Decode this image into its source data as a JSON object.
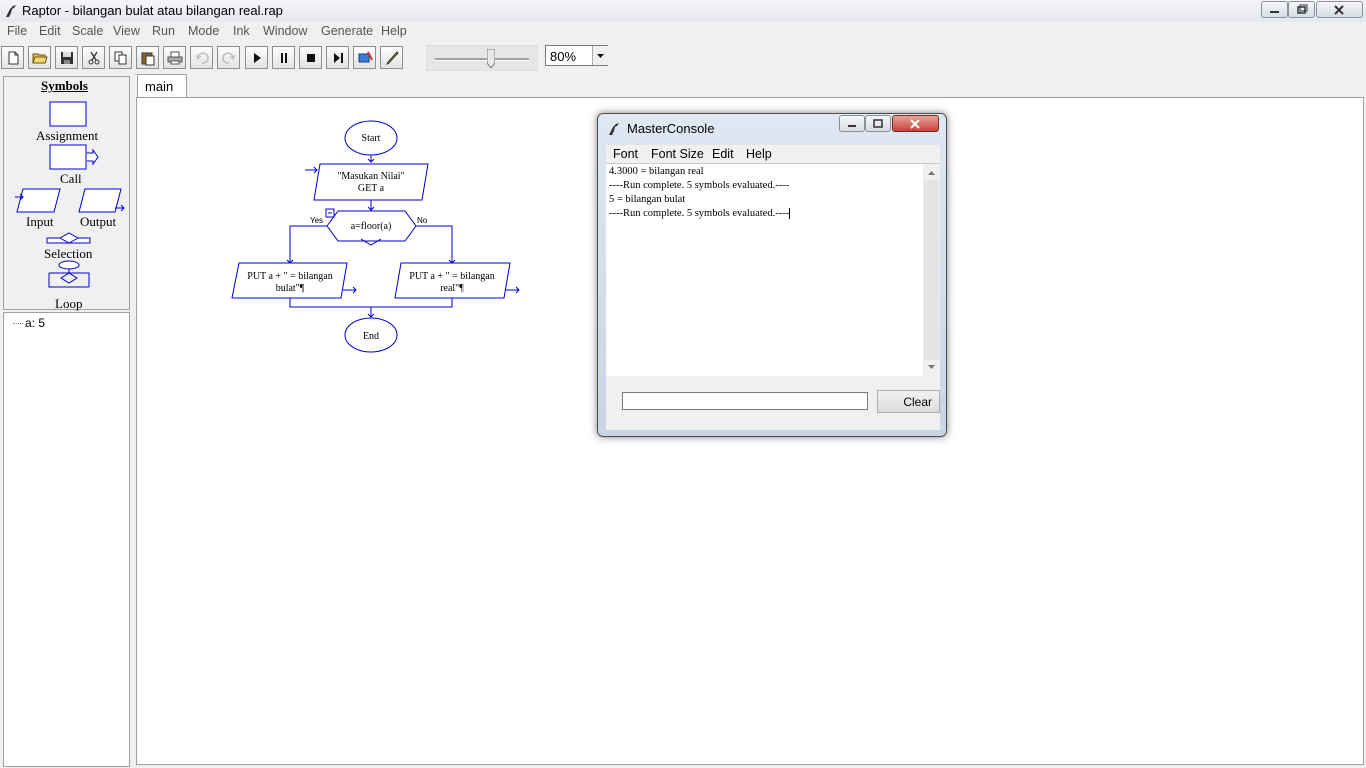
{
  "window": {
    "title": "Raptor - bilangan bulat atau bilangan real.rap"
  },
  "menu": [
    "File",
    "Edit",
    "Scale",
    "View",
    "Run",
    "Mode",
    "Ink",
    "Window",
    "Generate",
    "Help"
  ],
  "toolbar": {
    "zoom_value": "80%",
    "speed_slider_fraction": 0.6
  },
  "palette": {
    "title": "Symbols",
    "items": [
      "Assignment",
      "Call",
      "Input",
      "Output",
      "Selection",
      "Loop"
    ]
  },
  "watch": {
    "variable": "a: 5"
  },
  "tabs": [
    "main"
  ],
  "flowchart": {
    "start": "Start",
    "input_prompt": "\"Masukan Nilai\"",
    "input_get": "GET a",
    "condition": "a=floor(a)",
    "yes_label": "Yes",
    "no_label": "No",
    "output_yes_line1": "PUT a + \" = bilangan",
    "output_yes_line2": "bulat\"¶",
    "output_no_line1": "PUT a + \" = bilangan",
    "output_no_line2": "real\"¶",
    "end": "End"
  },
  "console": {
    "title": "MasterConsole",
    "menu": [
      "Font",
      "Font Size",
      "Edit",
      "Help"
    ],
    "output": [
      "4.3000 = bilangan real",
      "----Run complete.  5 symbols evaluated.----",
      "5 = bilangan bulat",
      "----Run complete.  5 symbols evaluated.----"
    ],
    "clear_label": "Clear",
    "input_value": ""
  },
  "colors": {
    "flow_blue": "#0000cc",
    "title_close_red": "#c8423a"
  },
  "icons": [
    "new-icon",
    "open-icon",
    "save-icon",
    "cut-icon",
    "copy-icon",
    "paste-icon",
    "print-icon",
    "undo-icon",
    "redo-icon",
    "play-icon",
    "pause-icon",
    "stop-icon",
    "step-icon",
    "ink-icon",
    "pen-icon"
  ]
}
